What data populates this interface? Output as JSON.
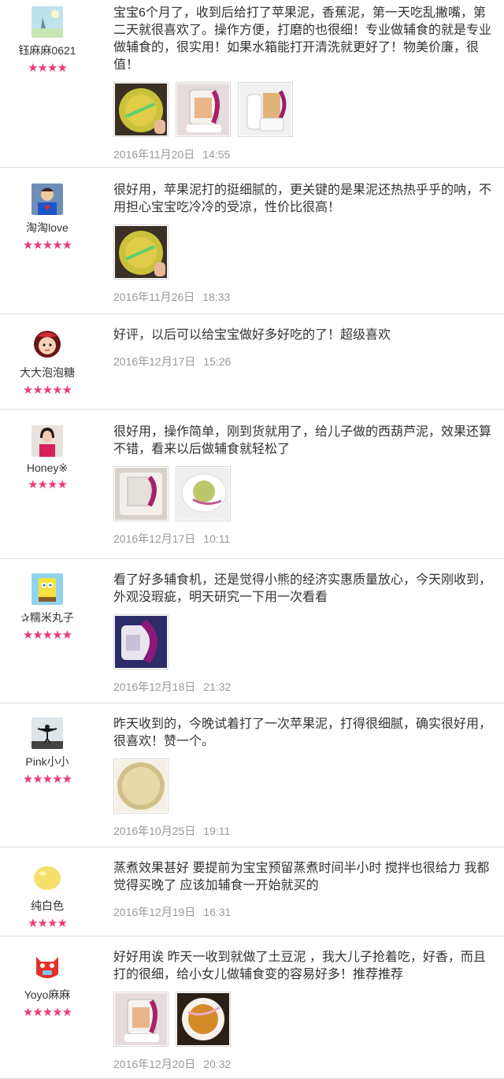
{
  "reviews": [
    {
      "username": "钰麻麻0621",
      "rating": 4,
      "avatar_icon": "sky-avatar-icon",
      "text": "宝宝6个月了，收到后给打了苹果泥，香蕉泥，第一天吃乱撇嘴，第二天就很喜欢了。操作方便，打磨的也很细！专业做辅食的就是专业做辅食的，很实用！如果水箱能打开清洗就更好了！物美价廉，很值！",
      "photos": [
        "bowl-puree-photo",
        "pink-food-maker-photo",
        "white-food-maker-photo"
      ],
      "date": "2016年11月20日",
      "time": "14:55"
    },
    {
      "username": "淘淘love",
      "rating": 5,
      "avatar_icon": "child-avatar-icon",
      "text": "很好用，苹果泥打的挺细腻的，更关键的是果泥还热热乎乎的呐，不用担心宝宝吃冷冷的受凉，性价比很高！",
      "photos": [
        "bowl-puree-photo"
      ],
      "date": "2016年11月26日",
      "time": "18:33"
    },
    {
      "username": "大大泡泡糖",
      "rating": 5,
      "avatar_icon": "cartoon-girl-avatar-icon",
      "text": "好评，以后可以给宝宝做好多好吃的了！超级喜欢",
      "photos": [],
      "date": "2016年12月17日",
      "time": "15:26"
    },
    {
      "username": "Honey※",
      "rating": 4,
      "avatar_icon": "woman-avatar-icon",
      "text": "很好用，操作简单，刚到货就用了，给儿子做的西葫芦泥，效果还算不错，看来以后做辅食就轻松了",
      "photos": [
        "food-maker-box-photo",
        "green-puree-photo"
      ],
      "date": "2016年12月17日",
      "time": "10:11"
    },
    {
      "username": "✰糯米丸子",
      "rating": 5,
      "avatar_icon": "sponge-avatar-icon",
      "text": "看了好多辅食机，还是觉得小熊的经济实惠质量放心，今天刚收到，外观没瑕疵，明天研究一下用一次看看",
      "photos": [
        "purple-food-maker-photo"
      ],
      "date": "2016年12月18日",
      "time": "21:32"
    },
    {
      "username": "Pink小小",
      "rating": 5,
      "avatar_icon": "silhouette-avatar-icon",
      "text": "昨天收到的，今晚试着打了一次苹果泥，打得很细腻，确实很好用，很喜欢！赞一个。",
      "photos": [
        "apple-puree-photo"
      ],
      "date": "2016年10月25日",
      "time": "19:11"
    },
    {
      "username": "纯白色",
      "rating": 4,
      "avatar_icon": "yellow-ball-avatar-icon",
      "text": "蒸煮效果甚好  要提前为宝宝预留蒸煮时间半小时  搅拌也很给力  我都觉得买晚了 应该加辅食一开始就买的",
      "photos": [],
      "date": "2016年12月19日",
      "time": "16:31"
    },
    {
      "username": "Yoyo麻麻",
      "rating": 5,
      "avatar_icon": "red-cat-avatar-icon",
      "text": "好好用诶  昨天一收到就做了土豆泥  ，我大儿子抢着吃，好香，而且打的很细，给小女儿做辅食变的容易好多！推荐推荐",
      "photos": [
        "pink-food-maker-photo",
        "potato-puree-photo"
      ],
      "date": "2016年12月20日",
      "time": "20:32"
    }
  ]
}
